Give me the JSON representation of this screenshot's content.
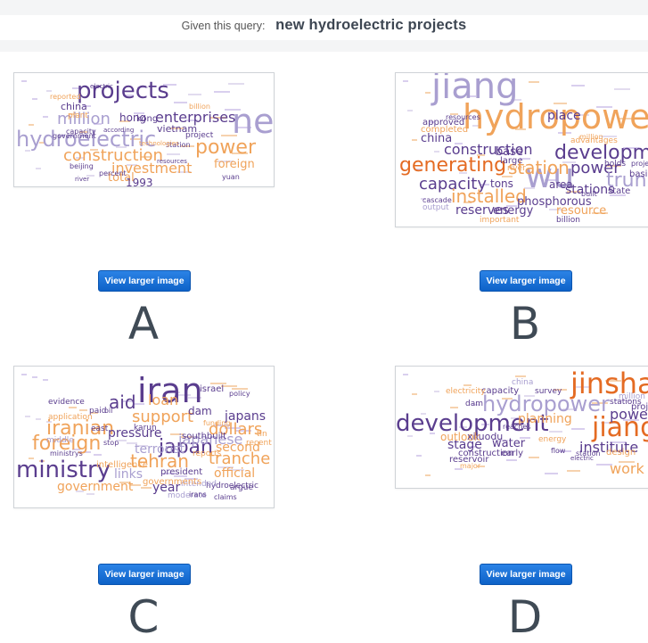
{
  "query": {
    "prompt": "Given this query:",
    "text": "new hydroelectric projects"
  },
  "button_label": "View larger image",
  "colors": {
    "purple": "#5a3d8e",
    "lavender": "#a99fd0",
    "orange": "#f0a35a",
    "dark_orange": "#e46b23",
    "button": "#1469d2"
  },
  "options": [
    {
      "letter": "A",
      "words": [
        {
          "t": "projects",
          "c": "purple"
        },
        {
          "t": "new",
          "c": "lavender"
        },
        {
          "t": "hydroelectric",
          "c": "lavender"
        },
        {
          "t": "million",
          "c": "lavender"
        },
        {
          "t": "construction",
          "c": "orange"
        },
        {
          "t": "power",
          "c": "orange"
        },
        {
          "t": "investment",
          "c": "orange"
        },
        {
          "t": "enterprises",
          "c": "purple"
        },
        {
          "t": "foreign",
          "c": "orange"
        },
        {
          "t": "total",
          "c": "orange"
        },
        {
          "t": "hong",
          "c": "purple"
        },
        {
          "t": "kong",
          "c": "purple"
        },
        {
          "t": "china",
          "c": "purple"
        },
        {
          "t": "plant",
          "c": "orange"
        },
        {
          "t": "vietnam",
          "c": "purple"
        },
        {
          "t": "project",
          "c": "purple"
        },
        {
          "t": "yuan",
          "c": "purple"
        },
        {
          "t": "billion",
          "c": "orange"
        },
        {
          "t": "station",
          "c": "purple"
        },
        {
          "t": "electric",
          "c": "purple"
        },
        {
          "t": "capacity",
          "c": "purple"
        },
        {
          "t": "according",
          "c": "purple"
        },
        {
          "t": "government",
          "c": "purple"
        },
        {
          "t": "percent",
          "c": "purple"
        },
        {
          "t": "river",
          "c": "purple"
        },
        {
          "t": "beijing",
          "c": "purple"
        },
        {
          "t": "resources",
          "c": "purple"
        },
        {
          "t": "technologies",
          "c": "orange"
        },
        {
          "t": "reported",
          "c": "orange"
        },
        {
          "t": "1993",
          "c": "purple"
        },
        {
          "t": "94",
          "c": "lavender"
        }
      ]
    },
    {
      "letter": "B",
      "words": [
        {
          "t": "jiang",
          "c": "lavender"
        },
        {
          "t": "hydropower",
          "c": "orange"
        },
        {
          "t": "wu",
          "c": "lavender"
        },
        {
          "t": "development",
          "c": "purple"
        },
        {
          "t": "generating",
          "c": "dark_orange"
        },
        {
          "t": "station",
          "c": "orange"
        },
        {
          "t": "capacity",
          "c": "purple"
        },
        {
          "t": "installed",
          "c": "orange"
        },
        {
          "t": "construction",
          "c": "purple"
        },
        {
          "t": "power",
          "c": "purple"
        },
        {
          "t": "trunk",
          "c": "lavender"
        },
        {
          "t": "china",
          "c": "purple"
        },
        {
          "t": "resources",
          "c": "purple"
        },
        {
          "t": "reserves",
          "c": "purple"
        },
        {
          "t": "energy",
          "c": "purple"
        },
        {
          "t": "phosphorous",
          "c": "purple"
        },
        {
          "t": "resource",
          "c": "orange"
        },
        {
          "t": "stations",
          "c": "purple"
        },
        {
          "t": "state",
          "c": "purple"
        },
        {
          "t": "tons",
          "c": "purple"
        },
        {
          "t": "area",
          "c": "purple"
        },
        {
          "t": "base",
          "c": "purple"
        },
        {
          "t": "place",
          "c": "purple"
        },
        {
          "t": "approved",
          "c": "purple"
        },
        {
          "t": "completed",
          "c": "orange"
        },
        {
          "t": "large",
          "c": "purple"
        },
        {
          "t": "cascade",
          "c": "purple"
        },
        {
          "t": "output",
          "c": "lavender"
        },
        {
          "t": "billion",
          "c": "purple"
        },
        {
          "t": "important",
          "c": "orange"
        },
        {
          "t": "built",
          "c": "purple"
        },
        {
          "t": "advantages",
          "c": "orange"
        },
        {
          "t": "holds",
          "c": "purple"
        },
        {
          "t": "river",
          "c": "orange"
        },
        {
          "t": "million",
          "c": "orange"
        },
        {
          "t": "basin",
          "c": "purple"
        },
        {
          "t": "proje",
          "c": "purple"
        }
      ]
    },
    {
      "letter": "C",
      "words": [
        {
          "t": "iran",
          "c": "purple"
        },
        {
          "t": "ministry",
          "c": "purple"
        },
        {
          "t": "foreign",
          "c": "orange"
        },
        {
          "t": "iranian",
          "c": "orange"
        },
        {
          "t": "japan",
          "c": "purple"
        },
        {
          "t": "tehran",
          "c": "orange"
        },
        {
          "t": "japans",
          "c": "purple"
        },
        {
          "t": "support",
          "c": "orange"
        },
        {
          "t": "dollars",
          "c": "orange"
        },
        {
          "t": "japanese",
          "c": "lavender"
        },
        {
          "t": "pressure",
          "c": "purple"
        },
        {
          "t": "aid",
          "c": "purple"
        },
        {
          "t": "tranche",
          "c": "orange"
        },
        {
          "t": "second",
          "c": "orange"
        },
        {
          "t": "terrorist",
          "c": "lavender"
        },
        {
          "t": "loan",
          "c": "orange"
        },
        {
          "t": "links",
          "c": "lavender"
        },
        {
          "t": "official",
          "c": "orange"
        },
        {
          "t": "government",
          "c": "orange"
        },
        {
          "t": "year",
          "c": "purple"
        },
        {
          "t": "dam",
          "c": "purple"
        },
        {
          "t": "israel",
          "c": "purple"
        },
        {
          "t": "policy",
          "c": "purple"
        },
        {
          "t": "karun",
          "c": "purple"
        },
        {
          "t": "southbuilt",
          "c": "purple"
        },
        {
          "t": "president",
          "c": "purple"
        },
        {
          "t": "hydroelectric",
          "c": "purple"
        },
        {
          "t": "recent",
          "c": "orange"
        },
        {
          "t": "reports",
          "c": "orange"
        },
        {
          "t": "funding",
          "c": "orange"
        },
        {
          "t": "intended",
          "c": "lavender"
        },
        {
          "t": "argue",
          "c": "purple"
        },
        {
          "t": "governments",
          "c": "orange"
        },
        {
          "t": "moderate",
          "c": "lavender"
        },
        {
          "t": "claims",
          "c": "purple"
        },
        {
          "t": "irans",
          "c": "purple"
        },
        {
          "t": "evidence",
          "c": "purple"
        },
        {
          "t": "application",
          "c": "orange"
        },
        {
          "t": "paid",
          "c": "purple"
        },
        {
          "t": "oil",
          "c": "purple"
        },
        {
          "t": "middle",
          "c": "lavender"
        },
        {
          "t": "east",
          "c": "purple"
        },
        {
          "t": "ministrys",
          "c": "purple"
        },
        {
          "t": "intelligence",
          "c": "orange"
        },
        {
          "t": "stop",
          "c": "purple"
        },
        {
          "t": "tin",
          "c": "orange"
        }
      ]
    },
    {
      "letter": "D",
      "words": [
        {
          "t": "jinsha",
          "c": "dark_orange"
        },
        {
          "t": "development",
          "c": "purple"
        },
        {
          "t": "hydropower",
          "c": "lavender"
        },
        {
          "t": "jiang",
          "c": "dark_orange"
        },
        {
          "t": "power",
          "c": "purple"
        },
        {
          "t": "planning",
          "c": "orange"
        },
        {
          "t": "institute",
          "c": "purple"
        },
        {
          "t": "work",
          "c": "orange"
        },
        {
          "t": "stage",
          "c": "purple"
        },
        {
          "t": "water",
          "c": "purple"
        },
        {
          "t": "outlook",
          "c": "orange"
        },
        {
          "t": "xiluodu",
          "c": "purple"
        },
        {
          "t": "capacity",
          "c": "purple"
        },
        {
          "t": "electricity",
          "c": "orange"
        },
        {
          "t": "survey",
          "c": "purple"
        },
        {
          "t": "stations",
          "c": "purple"
        },
        {
          "t": "million",
          "c": "lavender"
        },
        {
          "t": "project",
          "c": "purple"
        },
        {
          "t": "dam",
          "c": "purple"
        },
        {
          "t": "construction",
          "c": "purple"
        },
        {
          "t": "early",
          "c": "purple"
        },
        {
          "t": "reservoir",
          "c": "purple"
        },
        {
          "t": "flow",
          "c": "purple"
        },
        {
          "t": "station",
          "c": "purple"
        },
        {
          "t": "design",
          "c": "orange"
        },
        {
          "t": "reaches",
          "c": "purple"
        },
        {
          "t": "energy",
          "c": "orange"
        },
        {
          "t": "electric",
          "c": "purple"
        },
        {
          "t": "china",
          "c": "lavender"
        },
        {
          "t": "major",
          "c": "orange"
        }
      ]
    }
  ]
}
